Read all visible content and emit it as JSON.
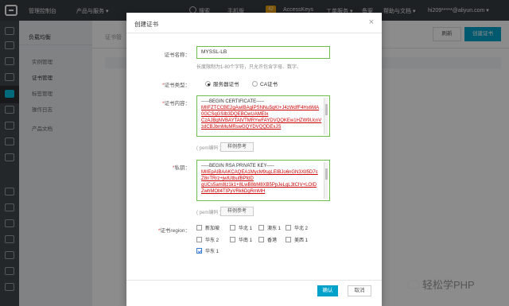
{
  "topbar": {
    "console": "管理控制台",
    "products": "产品与服务 ▾",
    "search": "搜索",
    "phone": "手机版",
    "badge": "42",
    "accesskeys": "AccessKeys",
    "tickets": "工单服务 ▾",
    "filing": "备案",
    "help": "帮助与文档 ▾",
    "user": "hi209*****@aliyun.com ▾"
  },
  "sidebar": {
    "title": "负载均衡",
    "items": [
      {
        "label": "实例管理"
      },
      {
        "label": "证书管理"
      },
      {
        "label": "标签管理"
      },
      {
        "label": "操作日志"
      },
      {
        "label": "产品文档"
      }
    ]
  },
  "main": {
    "breadcrumb": "证书管",
    "refresh": "刷新",
    "create": "创建证书"
  },
  "modal": {
    "title": "创建证书",
    "close": "×",
    "name_label": "证书名称：",
    "name_value": "MYSSL-LB",
    "name_hint": "长度限制为1-80个字符，只允许包含字母、数字、",
    "type_label": "证书类型：",
    "type_server": "服务器证书",
    "type_ca": "CA证书",
    "content_label": "证书内容：",
    "content_lines": [
      "-----BEGIN CERTIFICATE-----",
      "MIIFZTCCBE2gAwIBAgIPSNNu5qKI+J4zWdfF4Hx6MA",
      "0GCSqGSIb3DQEBCwUAMEIx",
      "CzAJBgNVBAYTAlVTMRYwFAYDVQQKEw1HZW9UcnV",
      "zdCBJbmMuMRswGQYDVQQDExJS"
    ],
    "pem_hint": "( pem编码 )",
    "sample_btn": "样例参考",
    "key_label": "私钥：",
    "key_lines": [
      "-----BEGIN RSA PRIVATE KEY-----",
      "MIIEpAIBAAKCAQEA1MycM9sgLEIBJo6nGN3XIl5D7c",
      "Z8nTRrz+jwtUtbufBPfdD",
      "gUCs5am8lz1k1+8LwB8bM8XB5PpJeLgL3tCIV+LOID",
      "ZwhMOll4TIPyVRk6DgRmMH"
    ],
    "region_label": "证书region：",
    "regions": [
      {
        "label": "新加坡",
        "checked": false
      },
      {
        "label": "华北 1",
        "checked": false
      },
      {
        "label": "澳东 1",
        "checked": false
      },
      {
        "label": "华北 2",
        "checked": false
      },
      {
        "label": "华东 2",
        "checked": false
      },
      {
        "label": "华南 1",
        "checked": false
      },
      {
        "label": "香港",
        "checked": false
      },
      {
        "label": "美西 1",
        "checked": false
      },
      {
        "label": "华东 1",
        "checked": true
      }
    ],
    "ok": "确认",
    "cancel": "取消"
  },
  "watermark": "轻松学PHP"
}
